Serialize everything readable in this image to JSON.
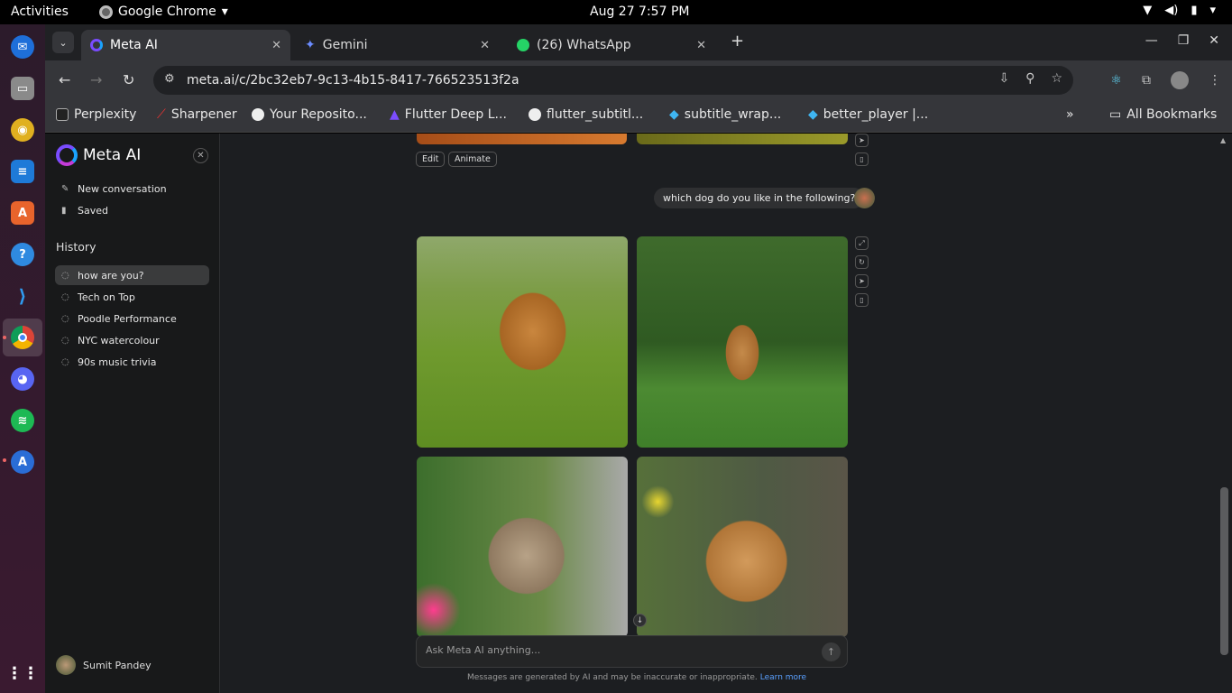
{
  "topbar": {
    "activities": "Activities",
    "app_name": "Google Chrome",
    "datetime": "Aug 27  7:57 PM"
  },
  "dock": {
    "icons": [
      "thunderbird-icon",
      "files-icon",
      "rhythmbox-icon",
      "writer-icon",
      "software-icon",
      "help-icon",
      "vscode-icon",
      "chrome-icon",
      "discord-icon",
      "spotify-icon",
      "updater-icon",
      "app-grid-icon"
    ]
  },
  "tabs": [
    {
      "title": "Meta AI",
      "active": true
    },
    {
      "title": "Gemini",
      "active": false
    },
    {
      "title": "(26) WhatsApp",
      "active": false
    }
  ],
  "toolbar": {
    "url": "meta.ai/c/2bc32eb7-9c13-4b15-8417-766523513f2a"
  },
  "bookmarks": {
    "items": [
      "Perplexity",
      "Sharpener",
      "Your Reposito...",
      "Flutter Deep L...",
      "flutter_subtitl...",
      "subtitle_wrap...",
      "better_player |..."
    ],
    "all_bookmarks": "All Bookmarks"
  },
  "sidebar": {
    "brand": "Meta AI",
    "new_conversation": "New conversation",
    "saved": "Saved",
    "history_label": "History",
    "history": [
      "how are you?",
      "Tech on Top",
      "Poodle Performance",
      "NYC watercolour",
      "90s music trivia"
    ],
    "user_name": "Sumit Pandey"
  },
  "chat": {
    "edit_label": "Edit",
    "animate_label": "Animate",
    "user_message": "which dog do you like in the following?",
    "composer_placeholder": "Ask Meta AI anything...",
    "disclaimer": "Messages are generated by AI and may be inaccurate or inappropriate.",
    "learn_more": "Learn more"
  }
}
